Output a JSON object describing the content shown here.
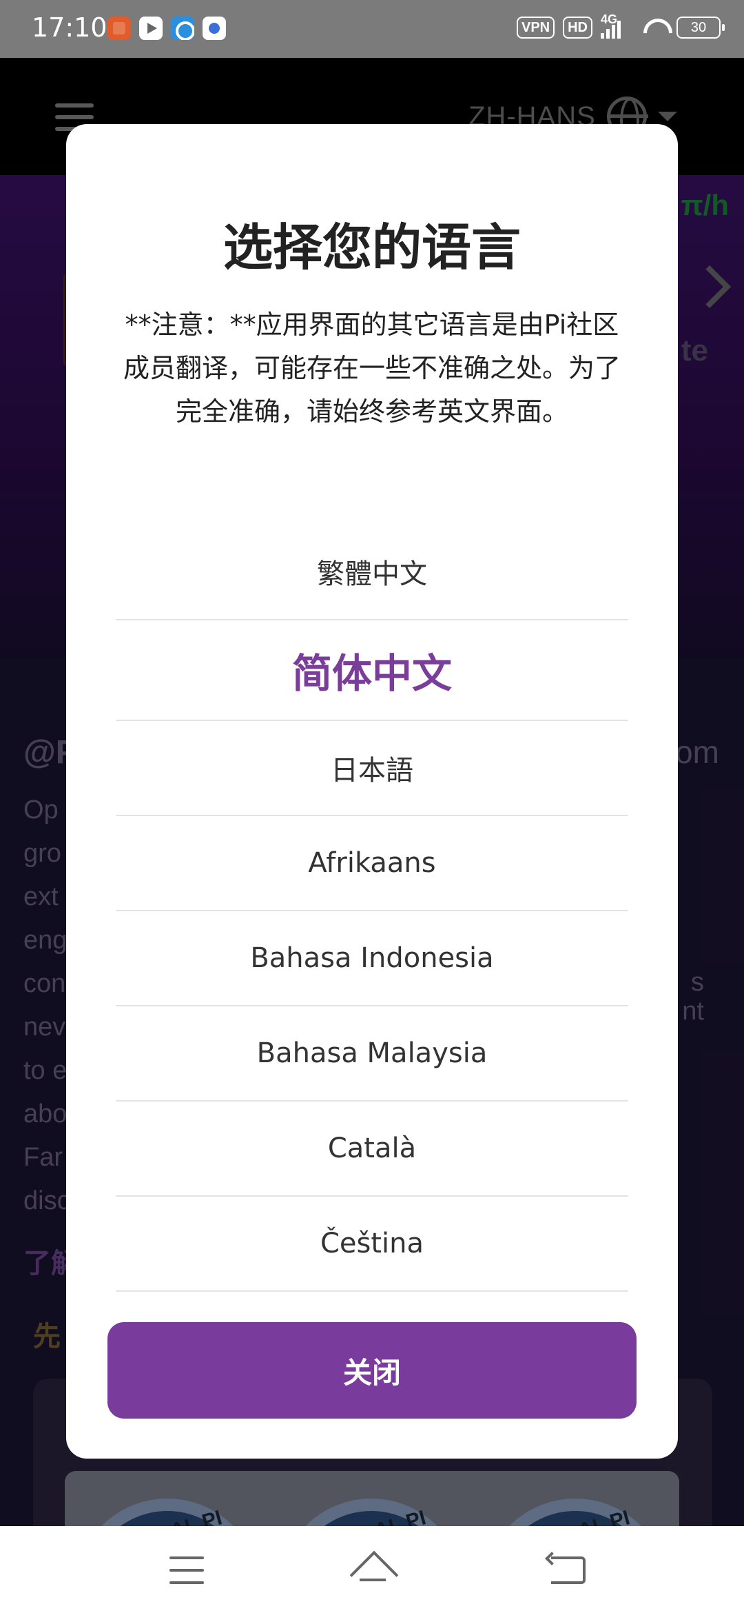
{
  "status_bar": {
    "time": "17:10",
    "indicators": [
      "VPN",
      "HD",
      "4G"
    ],
    "battery": "30"
  },
  "background": {
    "header_lang": "ZH-HANS",
    "hero_rate": "π/h",
    "hero_partial": "te",
    "handle_partial": "@P",
    "handle_tail": "om",
    "body_fragments": [
      "Op",
      "gro",
      "ext",
      "eng",
      "con",
      "nev",
      "to e",
      "abo",
      "Far",
      "disc"
    ],
    "right_fragments": [
      "s",
      "nt"
    ],
    "learn_more_partial": "了解",
    "gold_partial": "先",
    "medal_text": "GLOBAL PI MARK"
  },
  "modal": {
    "title": "选择您的语言",
    "note": "**注意：**应用界面的其它语言是由Pi社区成员翻译，可能存在一些不准确之处。为了完全准确，请始终参考英文界面。",
    "languages": [
      {
        "label": "繁體中文",
        "selected": false
      },
      {
        "label": "简体中文",
        "selected": true
      },
      {
        "label": "日本語",
        "selected": false
      },
      {
        "label": "Afrikaans",
        "selected": false
      },
      {
        "label": "Bahasa Indonesia",
        "selected": false
      },
      {
        "label": "Bahasa Malaysia",
        "selected": false
      },
      {
        "label": "Català",
        "selected": false
      },
      {
        "label": "Čeština",
        "selected": false
      }
    ],
    "close_label": "关闭"
  },
  "colors": {
    "accent": "#7a3c9c",
    "selected_text": "#7a3d9a"
  },
  "icons": [
    "menu-icon",
    "globe-icon",
    "chevron-down-icon",
    "nav-menu-icon",
    "nav-home-icon",
    "nav-back-icon"
  ]
}
